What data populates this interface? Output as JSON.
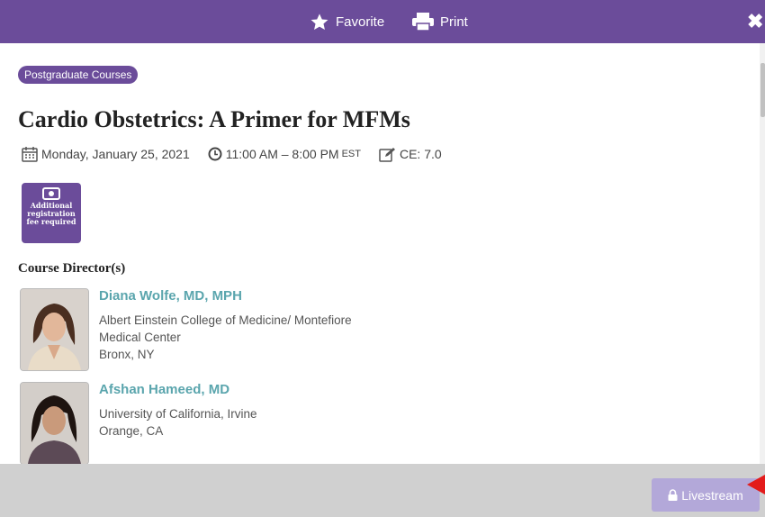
{
  "toolbar": {
    "favorite_label": "Favorite",
    "print_label": "Print",
    "close_glyph": "✖"
  },
  "event": {
    "tag": "Postgraduate Courses",
    "title": "Cardio Obstetrics: A Primer for MFMs",
    "date": "Monday, January 25, 2021",
    "time": "11:00 AM – 8:00 PM",
    "timezone": "EST",
    "ce": "CE: 7.0",
    "fee_badge": {
      "line1": "Additional",
      "line2": "registration",
      "line3": "fee required"
    }
  },
  "directors": {
    "heading": "Course Director(s)",
    "people": [
      {
        "name": "Diana Wolfe, MD, MPH",
        "org_line1": "Albert Einstein College of Medicine/ Montefiore",
        "org_line2": "Medical Center",
        "location": "Bronx, NY"
      },
      {
        "name": "Afshan Hameed, MD",
        "org_line1": "University of California, Irvine",
        "location": "Orange, CA"
      }
    ]
  },
  "footer": {
    "livestream_label": "Livestream"
  },
  "colors": {
    "brand": "#6b4c9a",
    "name_link": "#5aa5ad",
    "livestream_disabled": "#b3a8d9",
    "pointer": "#e31b1b"
  },
  "icons": [
    "star-icon",
    "printer-icon",
    "close-icon",
    "calendar-icon",
    "clock-icon",
    "edit-icon",
    "ticket-icon",
    "lock-icon"
  ]
}
